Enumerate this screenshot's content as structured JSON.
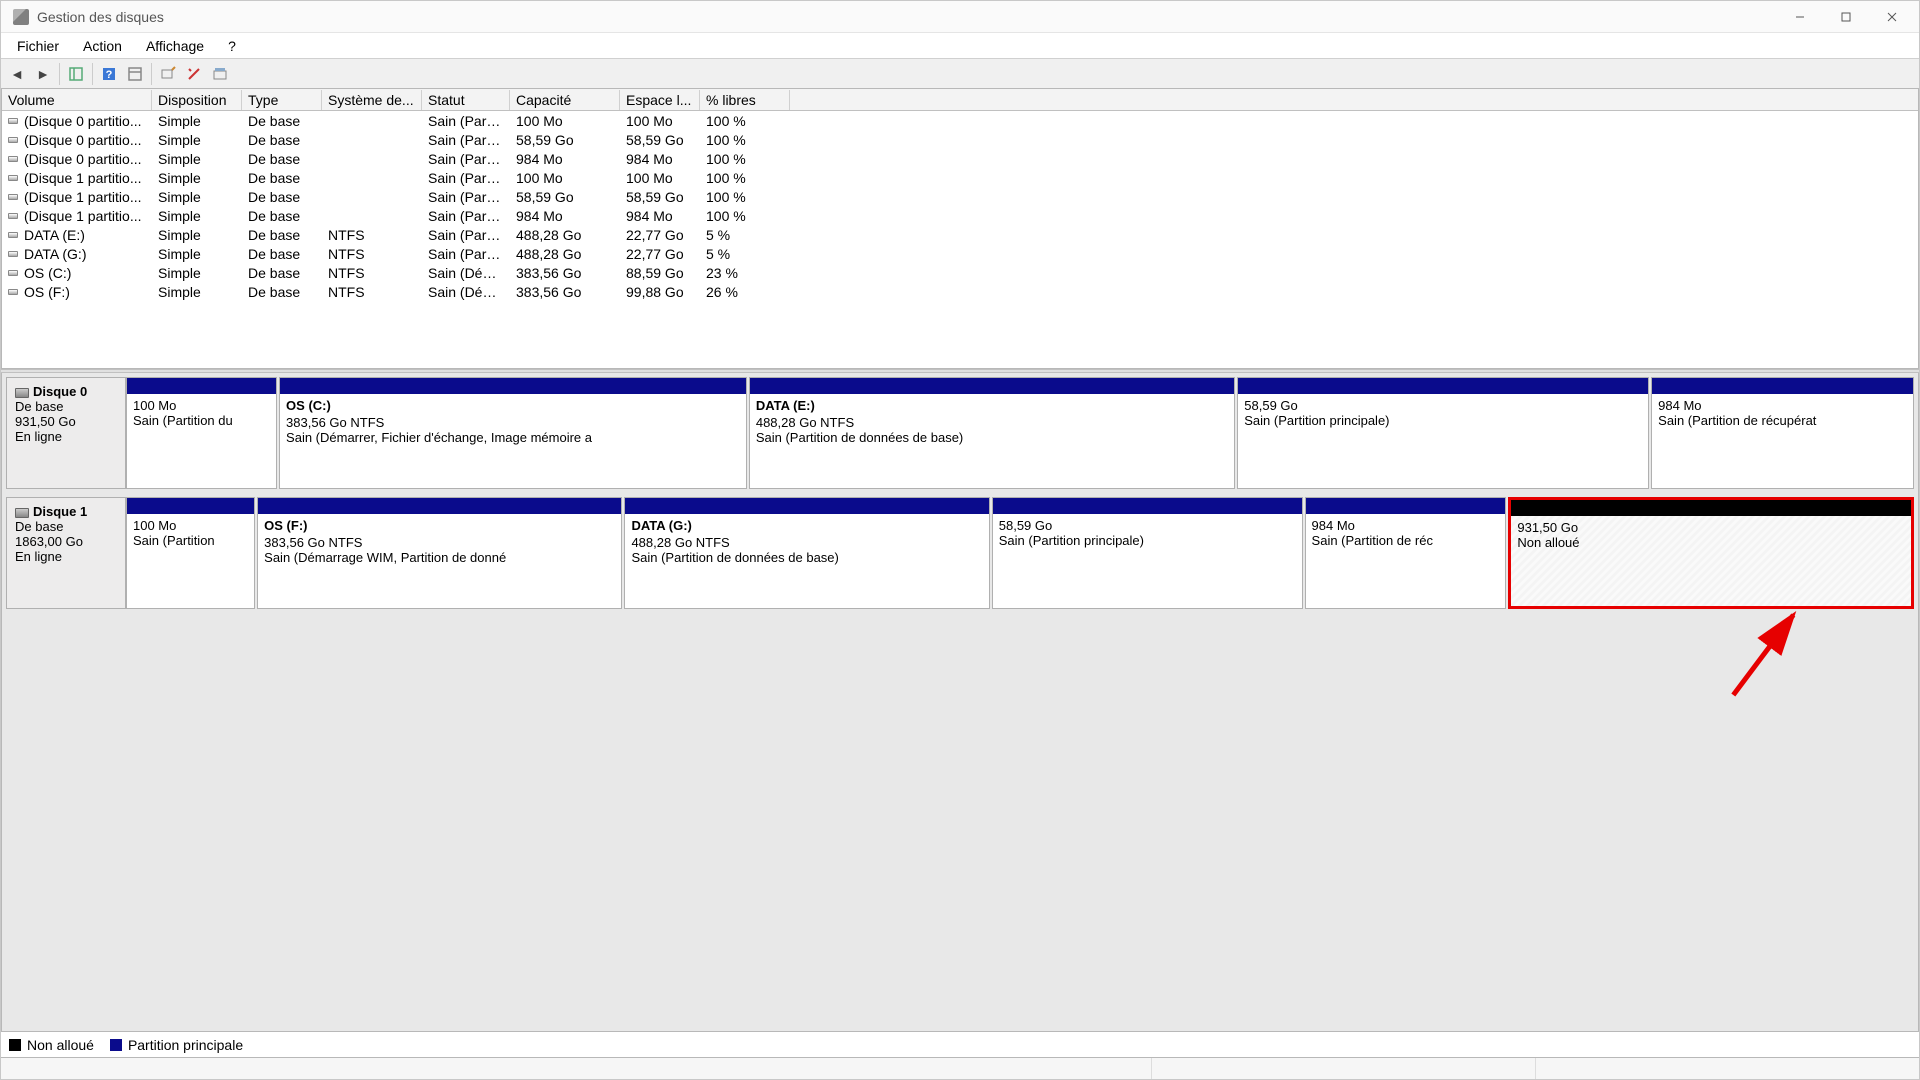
{
  "window": {
    "title": "Gestion des disques"
  },
  "menubar": {
    "items": [
      "Fichier",
      "Action",
      "Affichage",
      "?"
    ]
  },
  "toolbar": {
    "icons": [
      "back-icon",
      "forward-icon",
      "up-icon",
      "help-icon",
      "refresh-icon",
      "properties-icon",
      "settings-icon",
      "view-icon"
    ]
  },
  "volume_table": {
    "headers": [
      "Volume",
      "Disposition",
      "Type",
      "Système de...",
      "Statut",
      "Capacité",
      "Espace l...",
      "% libres"
    ],
    "rows": [
      {
        "volume": "(Disque 0 partitio...",
        "dispo": "Simple",
        "type": "De base",
        "fs": "",
        "statut": "Sain (Parti...",
        "cap": "100 Mo",
        "free": "100 Mo",
        "pct": "100 %"
      },
      {
        "volume": "(Disque 0 partitio...",
        "dispo": "Simple",
        "type": "De base",
        "fs": "",
        "statut": "Sain (Parti...",
        "cap": "58,59 Go",
        "free": "58,59 Go",
        "pct": "100 %"
      },
      {
        "volume": "(Disque 0 partitio...",
        "dispo": "Simple",
        "type": "De base",
        "fs": "",
        "statut": "Sain (Parti...",
        "cap": "984 Mo",
        "free": "984 Mo",
        "pct": "100 %"
      },
      {
        "volume": "(Disque 1 partitio...",
        "dispo": "Simple",
        "type": "De base",
        "fs": "",
        "statut": "Sain (Parti...",
        "cap": "100 Mo",
        "free": "100 Mo",
        "pct": "100 %"
      },
      {
        "volume": "(Disque 1 partitio...",
        "dispo": "Simple",
        "type": "De base",
        "fs": "",
        "statut": "Sain (Parti...",
        "cap": "58,59 Go",
        "free": "58,59 Go",
        "pct": "100 %"
      },
      {
        "volume": "(Disque 1 partitio...",
        "dispo": "Simple",
        "type": "De base",
        "fs": "",
        "statut": "Sain (Parti...",
        "cap": "984 Mo",
        "free": "984 Mo",
        "pct": "100 %"
      },
      {
        "volume": "DATA (E:)",
        "dispo": "Simple",
        "type": "De base",
        "fs": "NTFS",
        "statut": "Sain (Parti...",
        "cap": "488,28 Go",
        "free": "22,77 Go",
        "pct": "5 %"
      },
      {
        "volume": "DATA (G:)",
        "dispo": "Simple",
        "type": "De base",
        "fs": "NTFS",
        "statut": "Sain (Parti...",
        "cap": "488,28 Go",
        "free": "22,77 Go",
        "pct": "5 %"
      },
      {
        "volume": "OS (C:)",
        "dispo": "Simple",
        "type": "De base",
        "fs": "NTFS",
        "statut": "Sain (Dém...",
        "cap": "383,56 Go",
        "free": "88,59 Go",
        "pct": "23 %"
      },
      {
        "volume": "OS (F:)",
        "dispo": "Simple",
        "type": "De base",
        "fs": "NTFS",
        "statut": "Sain (Dém...",
        "cap": "383,56 Go",
        "free": "99,88 Go",
        "pct": "26 %"
      }
    ]
  },
  "disks": [
    {
      "label": "Disque 0",
      "type": "De base",
      "capacity": "931,50 Go",
      "status": "En ligne",
      "partitions": [
        {
          "name": "",
          "size": "100 Mo",
          "stat": "Sain (Partition du",
          "flex": 8,
          "kind": "alloc"
        },
        {
          "name": "OS  (C:)",
          "size": "383,56 Go NTFS",
          "stat": "Sain (Démarrer, Fichier d'échange, Image mémoire a",
          "flex": 25,
          "kind": "alloc"
        },
        {
          "name": "DATA  (E:)",
          "size": "488,28 Go NTFS",
          "stat": "Sain (Partition de données de base)",
          "flex": 26,
          "kind": "alloc"
        },
        {
          "name": "",
          "size": "58,59 Go",
          "stat": "Sain (Partition principale)",
          "flex": 22,
          "kind": "alloc"
        },
        {
          "name": "",
          "size": "984 Mo",
          "stat": "Sain (Partition de récupérat",
          "flex": 14,
          "kind": "alloc"
        }
      ]
    },
    {
      "label": "Disque 1",
      "type": "De base",
      "capacity": "1863,00 Go",
      "status": "En ligne",
      "partitions": [
        {
          "name": "",
          "size": "100 Mo",
          "stat": "Sain (Partition",
          "flex": 7,
          "kind": "alloc"
        },
        {
          "name": "OS  (F:)",
          "size": "383,56 Go NTFS",
          "stat": "Sain (Démarrage WIM, Partition de donné",
          "flex": 20,
          "kind": "alloc"
        },
        {
          "name": "DATA  (G:)",
          "size": "488,28 Go NTFS",
          "stat": "Sain (Partition de données de base)",
          "flex": 20,
          "kind": "alloc"
        },
        {
          "name": "",
          "size": "58,59 Go",
          "stat": "Sain (Partition principale)",
          "flex": 17,
          "kind": "alloc"
        },
        {
          "name": "",
          "size": "984 Mo",
          "stat": "Sain (Partition de réc",
          "flex": 11,
          "kind": "alloc"
        },
        {
          "name": "",
          "size": "931,50 Go",
          "stat": "Non alloué",
          "flex": 22,
          "kind": "unalloc",
          "highlight": true
        }
      ]
    }
  ],
  "legend": {
    "unalloc": "Non alloué",
    "principal": "Partition principale"
  }
}
